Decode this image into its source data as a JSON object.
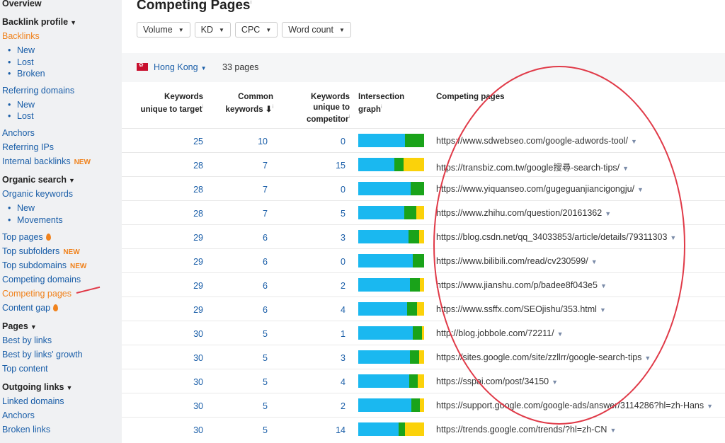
{
  "sidebar": {
    "overview": "Overview",
    "backlink_profile": "Backlink profile",
    "backlinks": "Backlinks",
    "bl_new": "New",
    "bl_lost": "Lost",
    "bl_broken": "Broken",
    "referring_domains": "Referring domains",
    "rd_new": "New",
    "rd_lost": "Lost",
    "anchors": "Anchors",
    "referring_ips": "Referring IPs",
    "internal_backlinks": "Internal backlinks",
    "organic_search": "Organic search",
    "organic_keywords": "Organic keywords",
    "ok_new": "New",
    "ok_movements": "Movements",
    "top_pages": "Top pages",
    "top_subfolders": "Top subfolders",
    "top_subdomains": "Top subdomains",
    "competing_domains": "Competing domains",
    "competing_pages": "Competing pages",
    "content_gap": "Content gap",
    "pages": "Pages",
    "best_by_links": "Best by links",
    "best_by_links_growth": "Best by links' growth",
    "top_content": "Top content",
    "outgoing_links": "Outgoing links",
    "linked_domains": "Linked domains",
    "anchors2": "Anchors",
    "broken_links": "Broken links",
    "new_tag": "NEW",
    "bullet": "•",
    "caret": "▼"
  },
  "header": {
    "title": "Competing Pages",
    "info_mark": "i",
    "filters": [
      "Volume",
      "KD",
      "CPC",
      "Word count"
    ],
    "country": "Hong Kong",
    "page_count": "33 pages"
  },
  "columns": {
    "kw_unique_target_1": "Keywords",
    "kw_unique_target_2": "unique to target",
    "common_1": "Common",
    "common_2": "keywords ⬇",
    "kw_unique_comp_1": "Keywords",
    "kw_unique_comp_2": "unique to",
    "kw_unique_comp_3": "competitor",
    "graph_1": "Intersection",
    "graph_2": "graph",
    "competing_pages": "Competing pages"
  },
  "colors": {
    "blue": "#1ab8f0",
    "green": "#1aa31a",
    "yellow": "#fbd20a",
    "link": "#1a5ea8",
    "accent": "#f0831e",
    "circle": "#e03a48"
  },
  "rows": [
    {
      "target": "25",
      "common": "10",
      "competitor": "0",
      "url": "https://www.sdwebseo.com/google-adwords-tool/",
      "bar": [
        0.71,
        0.29,
        0
      ]
    },
    {
      "target": "28",
      "common": "7",
      "competitor": "15",
      "url": "https://transbiz.com.tw/google搜尋-search-tips/",
      "bar": [
        0.55,
        0.14,
        0.31
      ]
    },
    {
      "target": "28",
      "common": "7",
      "competitor": "0",
      "url": "https://www.yiquanseo.com/gugeguanjiancigongju/",
      "bar": [
        0.8,
        0.2,
        0
      ]
    },
    {
      "target": "28",
      "common": "7",
      "competitor": "5",
      "url": "https://www.zhihu.com/question/20161362",
      "bar": [
        0.7,
        0.18,
        0.12
      ]
    },
    {
      "target": "29",
      "common": "6",
      "competitor": "3",
      "url": "https://blog.csdn.net/qq_34033853/article/details/79311303",
      "bar": [
        0.76,
        0.16,
        0.08
      ]
    },
    {
      "target": "29",
      "common": "6",
      "competitor": "0",
      "url": "https://www.bilibili.com/read/cv230599/",
      "bar": [
        0.83,
        0.17,
        0
      ]
    },
    {
      "target": "29",
      "common": "6",
      "competitor": "2",
      "url": "https://www.jianshu.com/p/badee8f043e5",
      "bar": [
        0.78,
        0.16,
        0.06
      ]
    },
    {
      "target": "29",
      "common": "6",
      "competitor": "4",
      "url": "https://www.ssffx.com/SEOjishu/353.html",
      "bar": [
        0.74,
        0.15,
        0.11
      ]
    },
    {
      "target": "30",
      "common": "5",
      "competitor": "1",
      "url": "http://blog.jobbole.com/72211/",
      "bar": [
        0.83,
        0.14,
        0.03
      ]
    },
    {
      "target": "30",
      "common": "5",
      "competitor": "3",
      "url": "https://sites.google.com/site/zzllrr/google-search-tips",
      "bar": [
        0.79,
        0.13,
        0.08
      ]
    },
    {
      "target": "30",
      "common": "5",
      "competitor": "4",
      "url": "https://sspai.com/post/34150",
      "bar": [
        0.77,
        0.13,
        0.1
      ]
    },
    {
      "target": "30",
      "common": "5",
      "competitor": "2",
      "url": "https://support.google.com/google-ads/answer/3114286?hl=zh-Hans",
      "bar": [
        0.81,
        0.13,
        0.06
      ]
    },
    {
      "target": "30",
      "common": "5",
      "competitor": "14",
      "url": "https://trends.google.com/trends/?hl=zh-CN",
      "bar": [
        0.61,
        0.1,
        0.29
      ]
    }
  ]
}
